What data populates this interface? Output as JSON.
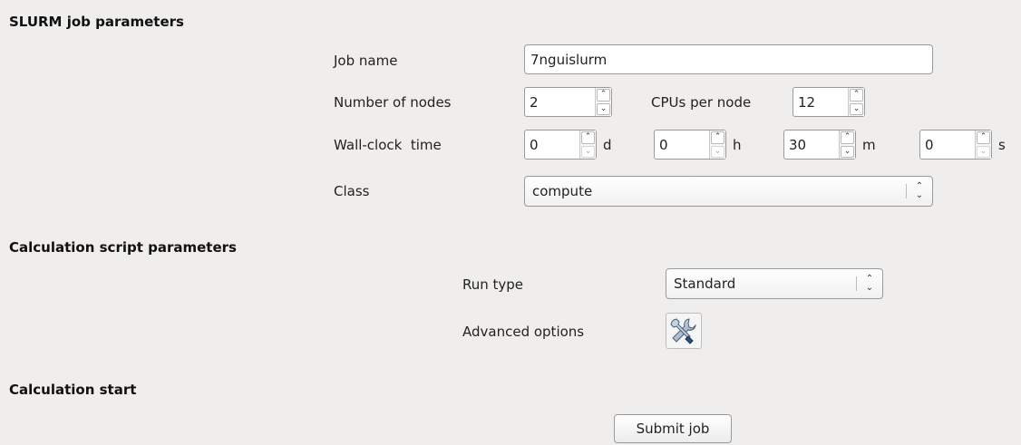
{
  "slurm": {
    "title": "SLURM job parameters",
    "job_name_label": "Job name",
    "job_name_value": "7nguislurm",
    "nodes_label": "Number of nodes",
    "nodes_value": "2",
    "cpus_label": "CPUs per node",
    "cpus_value": "12",
    "wall_label": "Wall-clock  time",
    "wall_days": "0",
    "wall_days_unit": "d",
    "wall_hours": "0",
    "wall_hours_unit": "h",
    "wall_minutes": "30",
    "wall_minutes_unit": "m",
    "wall_seconds": "0",
    "wall_seconds_unit": "s",
    "class_label": "Class",
    "class_value": "compute"
  },
  "calc_script": {
    "title": "Calculation script parameters",
    "run_type_label": "Run type",
    "run_type_value": "Standard",
    "advanced_label": "Advanced options",
    "advanced_icon": "tools-icon"
  },
  "calc_start": {
    "title": "Calculation start",
    "submit_label": "Submit job"
  }
}
